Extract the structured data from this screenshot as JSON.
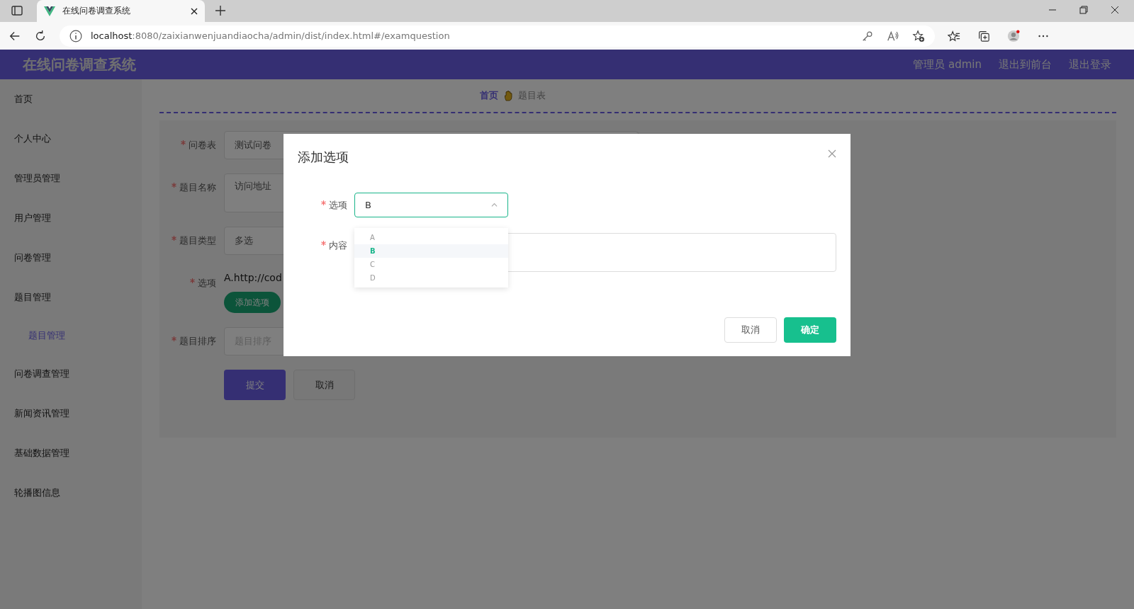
{
  "browser": {
    "tab_title": "在线问卷调查系统",
    "url_host": "localhost",
    "url_rest": ":8080/zaixianwenjuandiaocha/admin/dist/index.html#/examquestion"
  },
  "header": {
    "title": "在线问卷调查系统",
    "links": [
      "管理员 admin",
      "退出到前台",
      "退出登录"
    ]
  },
  "sidebar": {
    "items": [
      {
        "label": "首页"
      },
      {
        "label": "个人中心"
      },
      {
        "label": "管理员管理"
      },
      {
        "label": "用户管理"
      },
      {
        "label": "问卷管理"
      },
      {
        "label": "题目管理",
        "children": [
          {
            "label": "题目管理",
            "selected": true
          }
        ]
      },
      {
        "label": "问卷调查管理"
      },
      {
        "label": "新闻资讯管理"
      },
      {
        "label": "基础数据管理"
      },
      {
        "label": "轮播图信息"
      }
    ]
  },
  "breadcrumb": [
    "首页",
    "题目表"
  ],
  "form": {
    "fields": [
      {
        "label": "问卷表",
        "required": true,
        "kind": "input",
        "value": "测试问卷"
      },
      {
        "label": "题目名称",
        "required": true,
        "kind": "textarea",
        "value": "访问地址"
      },
      {
        "label": "题目类型",
        "required": true,
        "kind": "select",
        "value": "多选"
      },
      {
        "label": "选项",
        "required": true,
        "kind": "text",
        "value": "A.http://cod",
        "button": "添加选项"
      },
      {
        "label": "题目排序",
        "required": true,
        "kind": "input",
        "placeholder": "题目排序"
      }
    ],
    "buttons": [
      "提交",
      "取消"
    ]
  },
  "dialog": {
    "title": "添加选项",
    "fields": [
      {
        "label": "选项",
        "required": true,
        "kind": "select",
        "value": "B"
      },
      {
        "label": "内容",
        "required": true,
        "kind": "textarea"
      }
    ],
    "dropdown": [
      {
        "label": "A",
        "selected": false
      },
      {
        "label": "B",
        "selected": true
      },
      {
        "label": "C",
        "selected": false
      },
      {
        "label": "D",
        "selected": false
      }
    ],
    "buttons": [
      "取消",
      "确定"
    ]
  }
}
